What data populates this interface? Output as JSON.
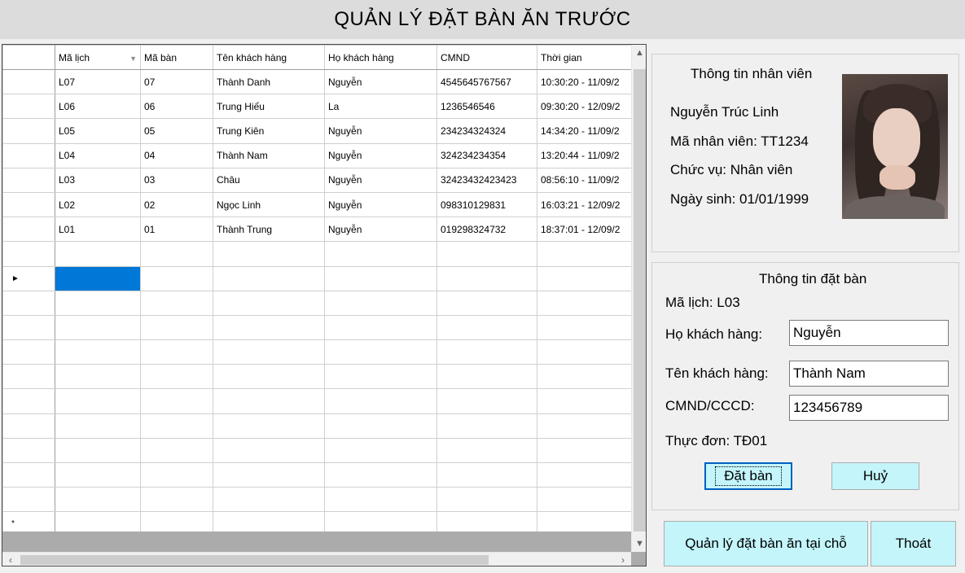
{
  "window": {
    "title": "QUẢN LÝ ĐẶT BÀN ĂN TRƯỚC"
  },
  "grid": {
    "columns": [
      "Mã lịch",
      "Mã bàn",
      "Tên khách hàng",
      "Họ khách hàng",
      "CMND",
      "Thời gian"
    ],
    "rows": [
      [
        "L07",
        "07",
        "Thành Danh",
        "Nguyễn",
        "4545645767567",
        "10:30:20 - 11/09/2"
      ],
      [
        "L06",
        "06",
        "Trung Hiếu",
        "La",
        "1236546546",
        "09:30:20 - 12/09/2"
      ],
      [
        "L05",
        "05",
        "Trung Kiên",
        "Nguyễn",
        "234234324324",
        "14:34:20 - 11/09/2"
      ],
      [
        "L04",
        "04",
        "Thành Nam",
        "Nguyễn",
        "324234234354",
        "13:20:44 - 11/09/2"
      ],
      [
        "L03",
        "03",
        "Châu",
        "Nguyễn",
        "32423432423423",
        "08:56:10 - 11/09/2"
      ],
      [
        "L02",
        "02",
        "Ngọc Linh",
        "Nguyễn",
        "098310129831",
        "16:03:21 - 12/09/2"
      ],
      [
        "L01",
        "01",
        "Thành Trung",
        "Nguyễn",
        "019298324732",
        "18:37:01 - 12/09/2"
      ]
    ],
    "current_row_marker": "►",
    "new_row_marker": "*",
    "sort_glyph": "▼"
  },
  "employee": {
    "heading": "Thông tin nhân viên",
    "name": "Nguyễn Trúc Linh",
    "id_line": "Mã nhân viên: TT1234",
    "role_line": "Chức vụ: Nhân viên",
    "dob_line": "Ngày sinh: 01/01/1999"
  },
  "booking": {
    "heading": "Thông tin đặt bàn",
    "schedule_line": "Mã lịch: L03",
    "last_name_label": "Họ khách hàng:",
    "last_name_value": "Nguyễn",
    "first_name_label": "Tên khách hàng:",
    "first_name_value": "Thành Nam",
    "id_label": "CMND/CCCD:",
    "id_value": "123456789",
    "menu_line": "Thực đơn: TĐ01"
  },
  "buttons": {
    "book": "Đặt bàn",
    "cancel": "Huỷ",
    "manage": "Quản lý đặt bàn ăn tại chỗ",
    "exit": "Thoát"
  },
  "colors": {
    "button_bg": "#c3f5fa",
    "selection": "#0078d7",
    "title_bar": "#dcdcdc"
  }
}
